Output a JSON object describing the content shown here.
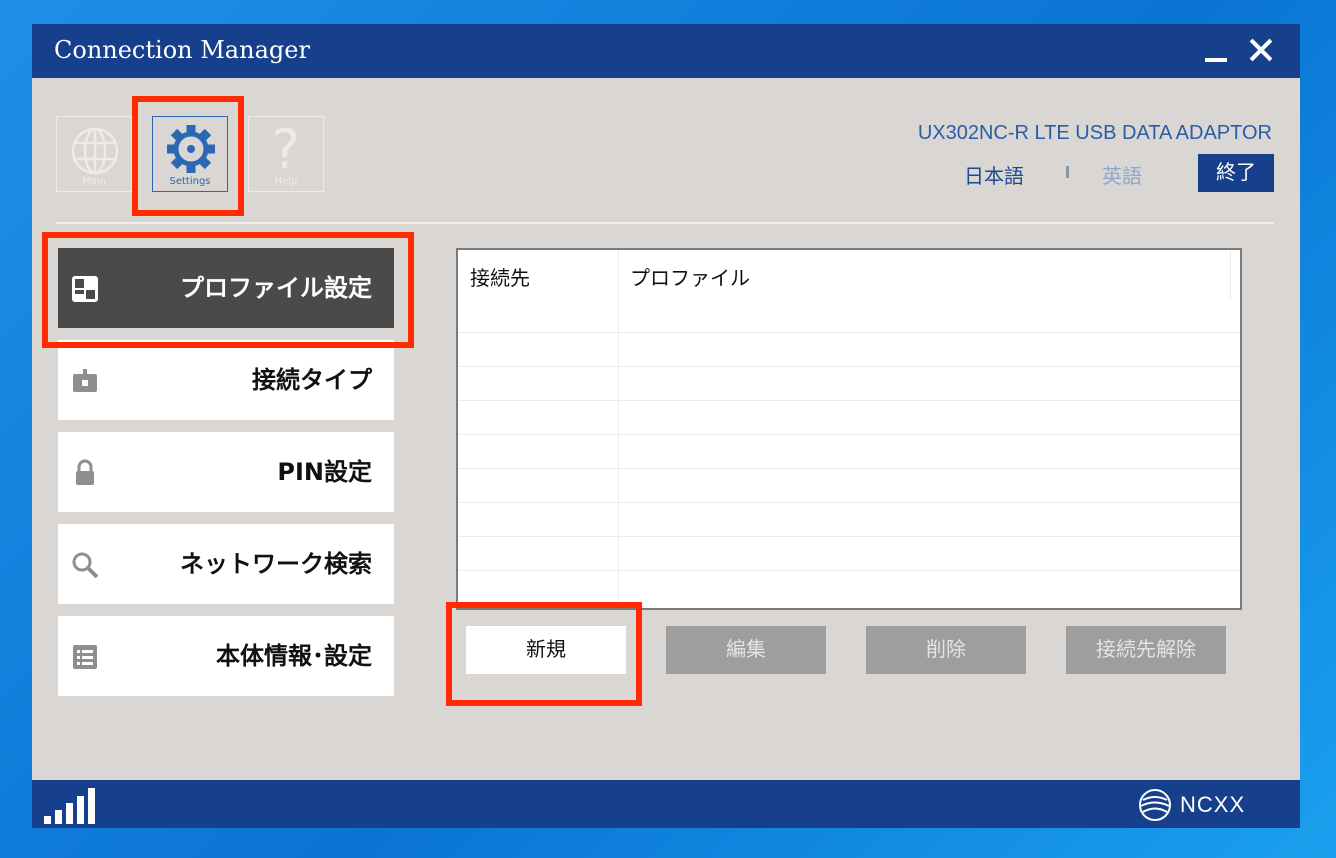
{
  "window": {
    "title": "Connection Manager"
  },
  "toolbar": {
    "main_label": "Main",
    "settings_label": "Settings",
    "help_label": "Help",
    "help_glyph": "?"
  },
  "device": {
    "model": "UX302NC-R LTE USB DATA ADAPTOR"
  },
  "language": {
    "japanese": "日本語",
    "english": "英語",
    "exit": "終了"
  },
  "sidebar": {
    "items": [
      {
        "label": "プロファイル設定",
        "icon": "profile-icon",
        "active": true
      },
      {
        "label": "接続タイプ",
        "icon": "connection-type-icon",
        "active": false
      },
      {
        "label": "PIN設定",
        "icon": "lock-icon",
        "active": false
      },
      {
        "label": "ネットワーク検索",
        "icon": "search-icon",
        "active": false
      },
      {
        "label": "本体情報･設定",
        "icon": "list-icon",
        "active": false
      }
    ]
  },
  "profile_table": {
    "columns": [
      "接続先",
      "プロファイル"
    ],
    "rows": []
  },
  "actions": {
    "new": "新規",
    "edit": "編集",
    "delete": "削除",
    "disconnect": "接続先解除"
  },
  "footer": {
    "brand": "NCXX"
  },
  "colors": {
    "titlebar": "#163f8c",
    "window_bg": "#d9d6d3",
    "active_item": "#4a4a4a",
    "highlight": "#ff2a00",
    "disabled_button": "#9e9e9e"
  }
}
